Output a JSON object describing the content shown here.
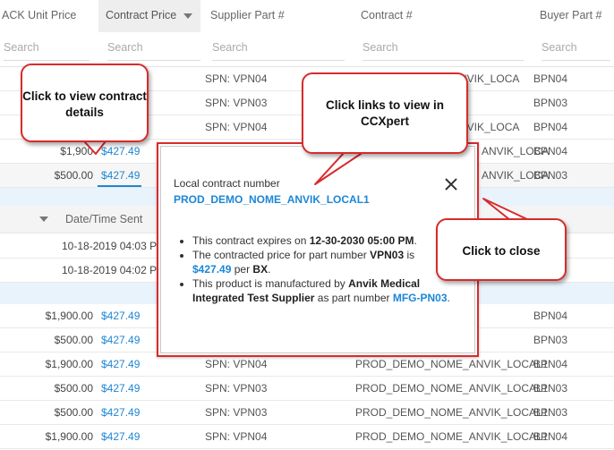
{
  "columns": {
    "ack_unit_price": "ACK Unit Price",
    "contract_price": "Contract Price",
    "supplier_part": "Supplier Part #",
    "contract_num": "Contract #",
    "buyer_part": "Buyer Part #",
    "date_time_sent": "Date/Time Sent"
  },
  "search_placeholder": "Search",
  "top_rows": [
    {
      "ack": "",
      "price": "",
      "supplier": "SPN: VPN04",
      "contract": "ANVIK_LOCA",
      "buyer": "BPN04"
    },
    {
      "ack": "",
      "price": "",
      "supplier": "SPN: VPN03",
      "contract": "",
      "buyer": "BPN03"
    },
    {
      "ack": "",
      "price": "",
      "supplier": "SPN: VPN04",
      "contract": "ANVIK_LOCA",
      "buyer": "BPN04"
    },
    {
      "ack": "$1,900",
      "price": "$427.49",
      "supplier": "",
      "contract": "ANVIK_LOCA",
      "buyer": "BPN04"
    },
    {
      "ack": "$500.00",
      "price": "$427.49",
      "supplier": "",
      "contract": "ANVIK_LOCA",
      "buyer": "BPN03"
    }
  ],
  "sent_rows": [
    {
      "date": "10-18-2019 04:03 PM"
    },
    {
      "date": "10-18-2019 04:02 PM"
    }
  ],
  "bottom_rows": [
    {
      "ack": "$1,900.00",
      "price": "$427.49",
      "supplier": "",
      "contract": "",
      "buyer": "BPN04"
    },
    {
      "ack": "$500.00",
      "price": "$427.49",
      "supplier": "",
      "contract": "",
      "buyer": "BPN03"
    },
    {
      "ack": "$1,900.00",
      "price": "$427.49",
      "supplier": "SPN: VPN04",
      "contract": "PROD_DEMO_NOME_ANVIK_LOCAL1",
      "buyer": "BPN04"
    },
    {
      "ack": "$500.00",
      "price": "$427.49",
      "supplier": "SPN: VPN03",
      "contract": "PROD_DEMO_NOME_ANVIK_LOCAL1",
      "buyer": "BPN03"
    },
    {
      "ack": "$500.00",
      "price": "$427.49",
      "supplier": "SPN: VPN03",
      "contract": "PROD_DEMO_NOME_ANVIK_LOCAL1",
      "buyer": "BPN03"
    },
    {
      "ack": "$1,900.00",
      "price": "$427.49",
      "supplier": "SPN: VPN04",
      "contract": "PROD_DEMO_NOME_ANVIK_LOCAL1",
      "buyer": "BPN04"
    }
  ],
  "popup": {
    "label": "Local contract number",
    "contract_number": "PROD_DEMO_NOME_ANVIK_LOCAL1",
    "b1_pre": "This contract expires on ",
    "b1_date": "12-30-2030 05:00 PM",
    "b1_post": ".",
    "b2_pre": "The contracted price for part number ",
    "b2_part": "VPN03",
    "b2_mid": " is ",
    "b2_price": "$427.49",
    "b2_per": " per ",
    "b2_unit": "BX",
    "b2_post": ".",
    "b3_pre": "This product is manufactured by ",
    "b3_mfr": "Anvik Medical Integrated Test Supplier",
    "b3_mid": " as part number ",
    "b3_part": "MFG-PN03",
    "b3_post": "."
  },
  "callouts": {
    "view_details": "Click to view contract details",
    "ccxpert": "Click links to view in CCXpert",
    "close": "Click to close"
  },
  "colors": {
    "link": "#1c86d6",
    "callout_border": "#d82b2b",
    "selected_band": "#e9f3fc"
  },
  "icons": {
    "sort": "caret-down-icon",
    "close": "x-icon"
  }
}
